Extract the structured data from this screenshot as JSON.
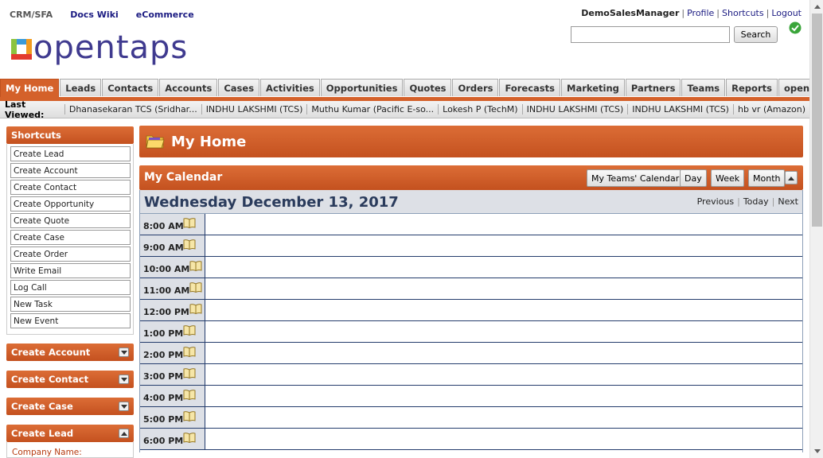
{
  "apps": {
    "crm": "CRM/SFA",
    "docs": "Docs Wiki",
    "ecommerce": "eCommerce"
  },
  "logo": {
    "text": "opentaps"
  },
  "user": {
    "name": "DemoSalesManager",
    "profile": "Profile",
    "shortcuts": "Shortcuts",
    "logout": "Logout"
  },
  "search": {
    "value": "",
    "button": "Search"
  },
  "tabs": [
    "My Home",
    "Leads",
    "Contacts",
    "Accounts",
    "Cases",
    "Activities",
    "Opportunities",
    "Quotes",
    "Orders",
    "Forecasts",
    "Marketing",
    "Partners",
    "Teams",
    "Reports",
    "opentaps"
  ],
  "last_viewed": {
    "label": "Last Viewed:",
    "items": [
      "Dhanasekaran TCS (Sridhar...",
      "INDHU LAKSHMI (TCS)",
      "Muthu Kumar (Pacific E-so...",
      "Lokesh P (TechM)",
      "INDHU LAKSHMI (TCS)",
      "INDHU LAKSHMI (TCS)",
      "hb vr (Amazon)"
    ]
  },
  "sidebar": {
    "shortcuts_title": "Shortcuts",
    "shortcuts": [
      "Create Lead",
      "Create Account",
      "Create Contact",
      "Create Opportunity",
      "Create Quote",
      "Create Case",
      "Create Order",
      "Write Email",
      "Log Call",
      "New Task",
      "New Event"
    ],
    "sections": [
      "Create Account",
      "Create Contact",
      "Create Case",
      "Create Lead"
    ],
    "company_name_label": "Company Name:"
  },
  "main": {
    "page_title": "My Home",
    "calendar_title": "My Calendar",
    "buttons": {
      "teams": "My Teams' Calendar",
      "day": "Day",
      "week": "Week",
      "month": "Month"
    },
    "date": "Wednesday December 13, 2017",
    "nav": {
      "previous": "Previous",
      "today": "Today",
      "next": "Next"
    },
    "slots": [
      "8:00 AM",
      "9:00 AM",
      "10:00 AM",
      "11:00 AM",
      "12:00 PM",
      "1:00 PM",
      "2:00 PM",
      "3:00 PM",
      "4:00 PM",
      "5:00 PM",
      "6:00 PM"
    ]
  },
  "colors": {
    "accent": "#d4612a",
    "navy": "#1b1b82",
    "date_text": "#2a3b5c",
    "grid_line": "#243c6c"
  }
}
